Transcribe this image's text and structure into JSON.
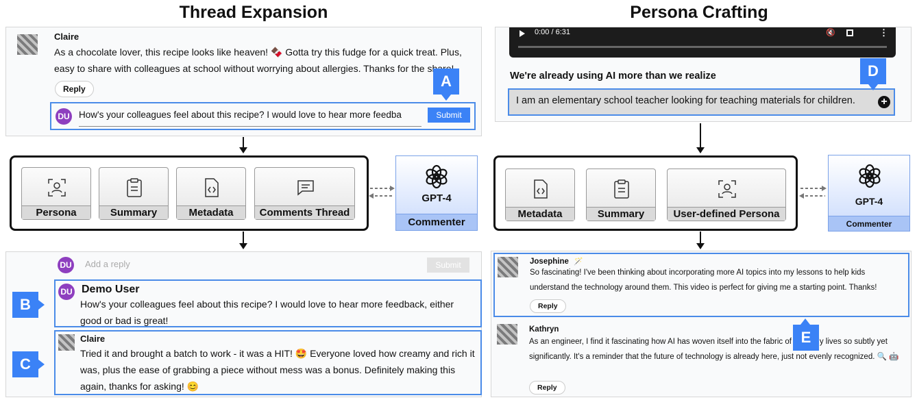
{
  "left": {
    "title": "Thread Expansion",
    "top_comment": {
      "author": "Claire",
      "text": "As a chocolate lover, this recipe looks like heaven! 🍫 Gotta try this fudge for a quick treat. Plus, easy to share with colleagues at school without worrying about allergies. Thanks for the share!",
      "reply_label": "Reply"
    },
    "input": {
      "avatar": "DU",
      "value": "How's your colleagues feel about this recipe? I would love to hear more feedba",
      "submit_label": "Submit"
    },
    "tags": {
      "a": "A",
      "b": "B",
      "c": "C"
    },
    "cards": [
      "Persona",
      "Summary",
      "Metadata",
      "Comments Thread"
    ],
    "gpt": {
      "name": "GPT-4",
      "label": "Commenter"
    },
    "bottom": {
      "reply_avatar": "DU",
      "reply_placeholder": "Add a reply",
      "submit_label": "Submit",
      "demo_user": {
        "avatar": "DU",
        "name": "Demo User",
        "text": "How's your colleagues feel about this recipe? I would love to hear more feedback, either good or bad is great!"
      },
      "claire": {
        "name": "Claire",
        "text": "Tried it and brought a batch to work - it was a HIT! 🤩 Everyone loved how creamy and rich it was, plus the ease of grabbing a piece without mess was a bonus. Definitely making this again, thanks for asking! 😊"
      }
    }
  },
  "right": {
    "title": "Persona Crafting",
    "video": {
      "time": "0:00 / 6:31"
    },
    "video_title": "We're already using AI more than we realize",
    "persona_input": "I am an elementary school teacher looking for teaching materials for children.",
    "tags": {
      "d": "D",
      "e": "E"
    },
    "cards": [
      "Metadata",
      "Summary",
      "User-defined Persona"
    ],
    "gpt": {
      "name": "GPT-4",
      "label": "Commenter"
    },
    "comments": [
      {
        "author": "Josephine",
        "badge": "🪄",
        "text": "So fascinating! I've been thinking about incorporating more AI topics into my lessons to help kids understand the technology around them. This video is perfect for giving me a starting point. Thanks!",
        "reply_label": "Reply"
      },
      {
        "author": "Kathryn",
        "text": "As an engineer, I find it fascinating how AI has woven itself into the fabric of our daily lives so subtly yet significantly. It's a reminder that the future of technology is already here, just not evenly recognized. 🔍 🤖",
        "reply_label": "Reply"
      }
    ]
  },
  "colors": {
    "accent": "#3b82f6",
    "avatar": "#8e3fbf",
    "gpt_fill": "#c9dafc"
  },
  "icons": [
    "persona-icon",
    "summary-icon",
    "metadata-icon",
    "comments-icon",
    "openai-icon",
    "plus-icon",
    "play-icon",
    "mute-icon",
    "fullscreen-icon",
    "more-icon"
  ]
}
